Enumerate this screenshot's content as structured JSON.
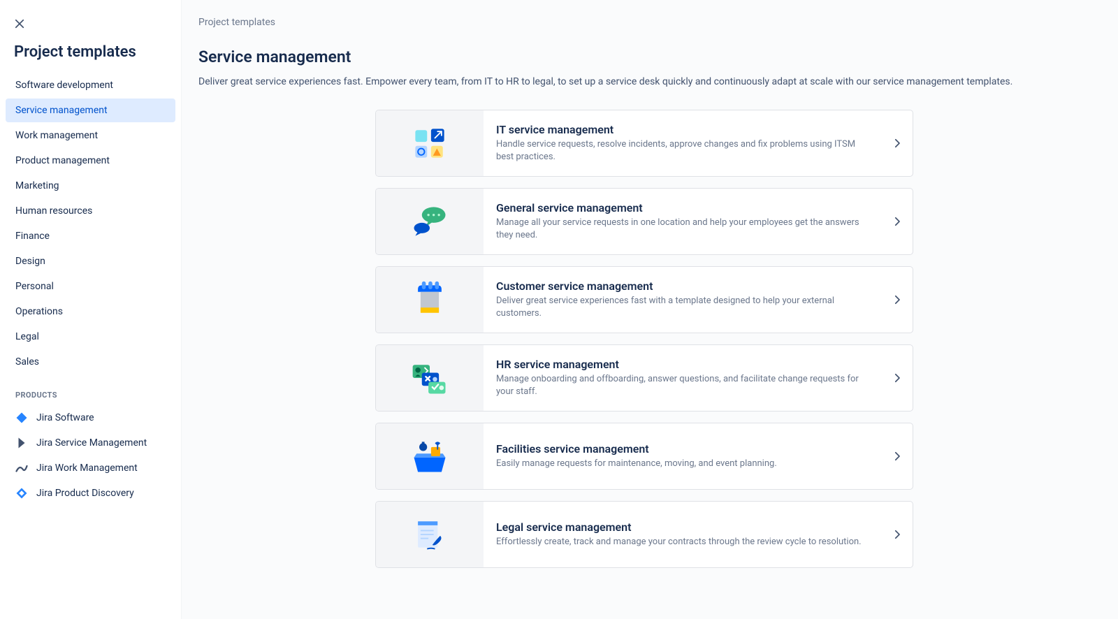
{
  "sidebar": {
    "title": "Project templates",
    "categories": [
      {
        "label": "Software development",
        "active": false
      },
      {
        "label": "Service management",
        "active": true
      },
      {
        "label": "Work management",
        "active": false
      },
      {
        "label": "Product management",
        "active": false
      },
      {
        "label": "Marketing",
        "active": false
      },
      {
        "label": "Human resources",
        "active": false
      },
      {
        "label": "Finance",
        "active": false
      },
      {
        "label": "Design",
        "active": false
      },
      {
        "label": "Personal",
        "active": false
      },
      {
        "label": "Operations",
        "active": false
      },
      {
        "label": "Legal",
        "active": false
      },
      {
        "label": "Sales",
        "active": false
      }
    ],
    "products_heading": "PRODUCTS",
    "products": [
      {
        "label": "Jira Software",
        "icon": "jira-software"
      },
      {
        "label": "Jira Service Management",
        "icon": "jira-service-mgmt"
      },
      {
        "label": "Jira Work Management",
        "icon": "jira-work-mgmt"
      },
      {
        "label": "Jira Product Discovery",
        "icon": "jira-product-discovery"
      }
    ]
  },
  "main": {
    "breadcrumb": "Project templates",
    "heading": "Service management",
    "description": "Deliver great service experiences fast. Empower every team, from IT to HR to legal, to set up a service desk quickly and continuously adapt at scale with our service management templates.",
    "cards": [
      {
        "title": "IT service management",
        "desc": "Handle service requests, resolve incidents, approve changes and fix problems using ITSM best practices.",
        "icon": "itsm"
      },
      {
        "title": "General service management",
        "desc": "Manage all your service requests in one location and help your employees get the answers they need.",
        "icon": "general"
      },
      {
        "title": "Customer service management",
        "desc": "Deliver great service experiences fast with a template designed to help your external customers.",
        "icon": "customer"
      },
      {
        "title": "HR service management",
        "desc": "Manage onboarding and offboarding, answer questions, and facilitate change requests for your staff.",
        "icon": "hr"
      },
      {
        "title": "Facilities service management",
        "desc": "Easily manage requests for maintenance, moving, and event planning.",
        "icon": "facilities"
      },
      {
        "title": "Legal service management",
        "desc": "Effortlessly create, track and manage your contracts through the review cycle to resolution.",
        "icon": "legal"
      }
    ]
  }
}
